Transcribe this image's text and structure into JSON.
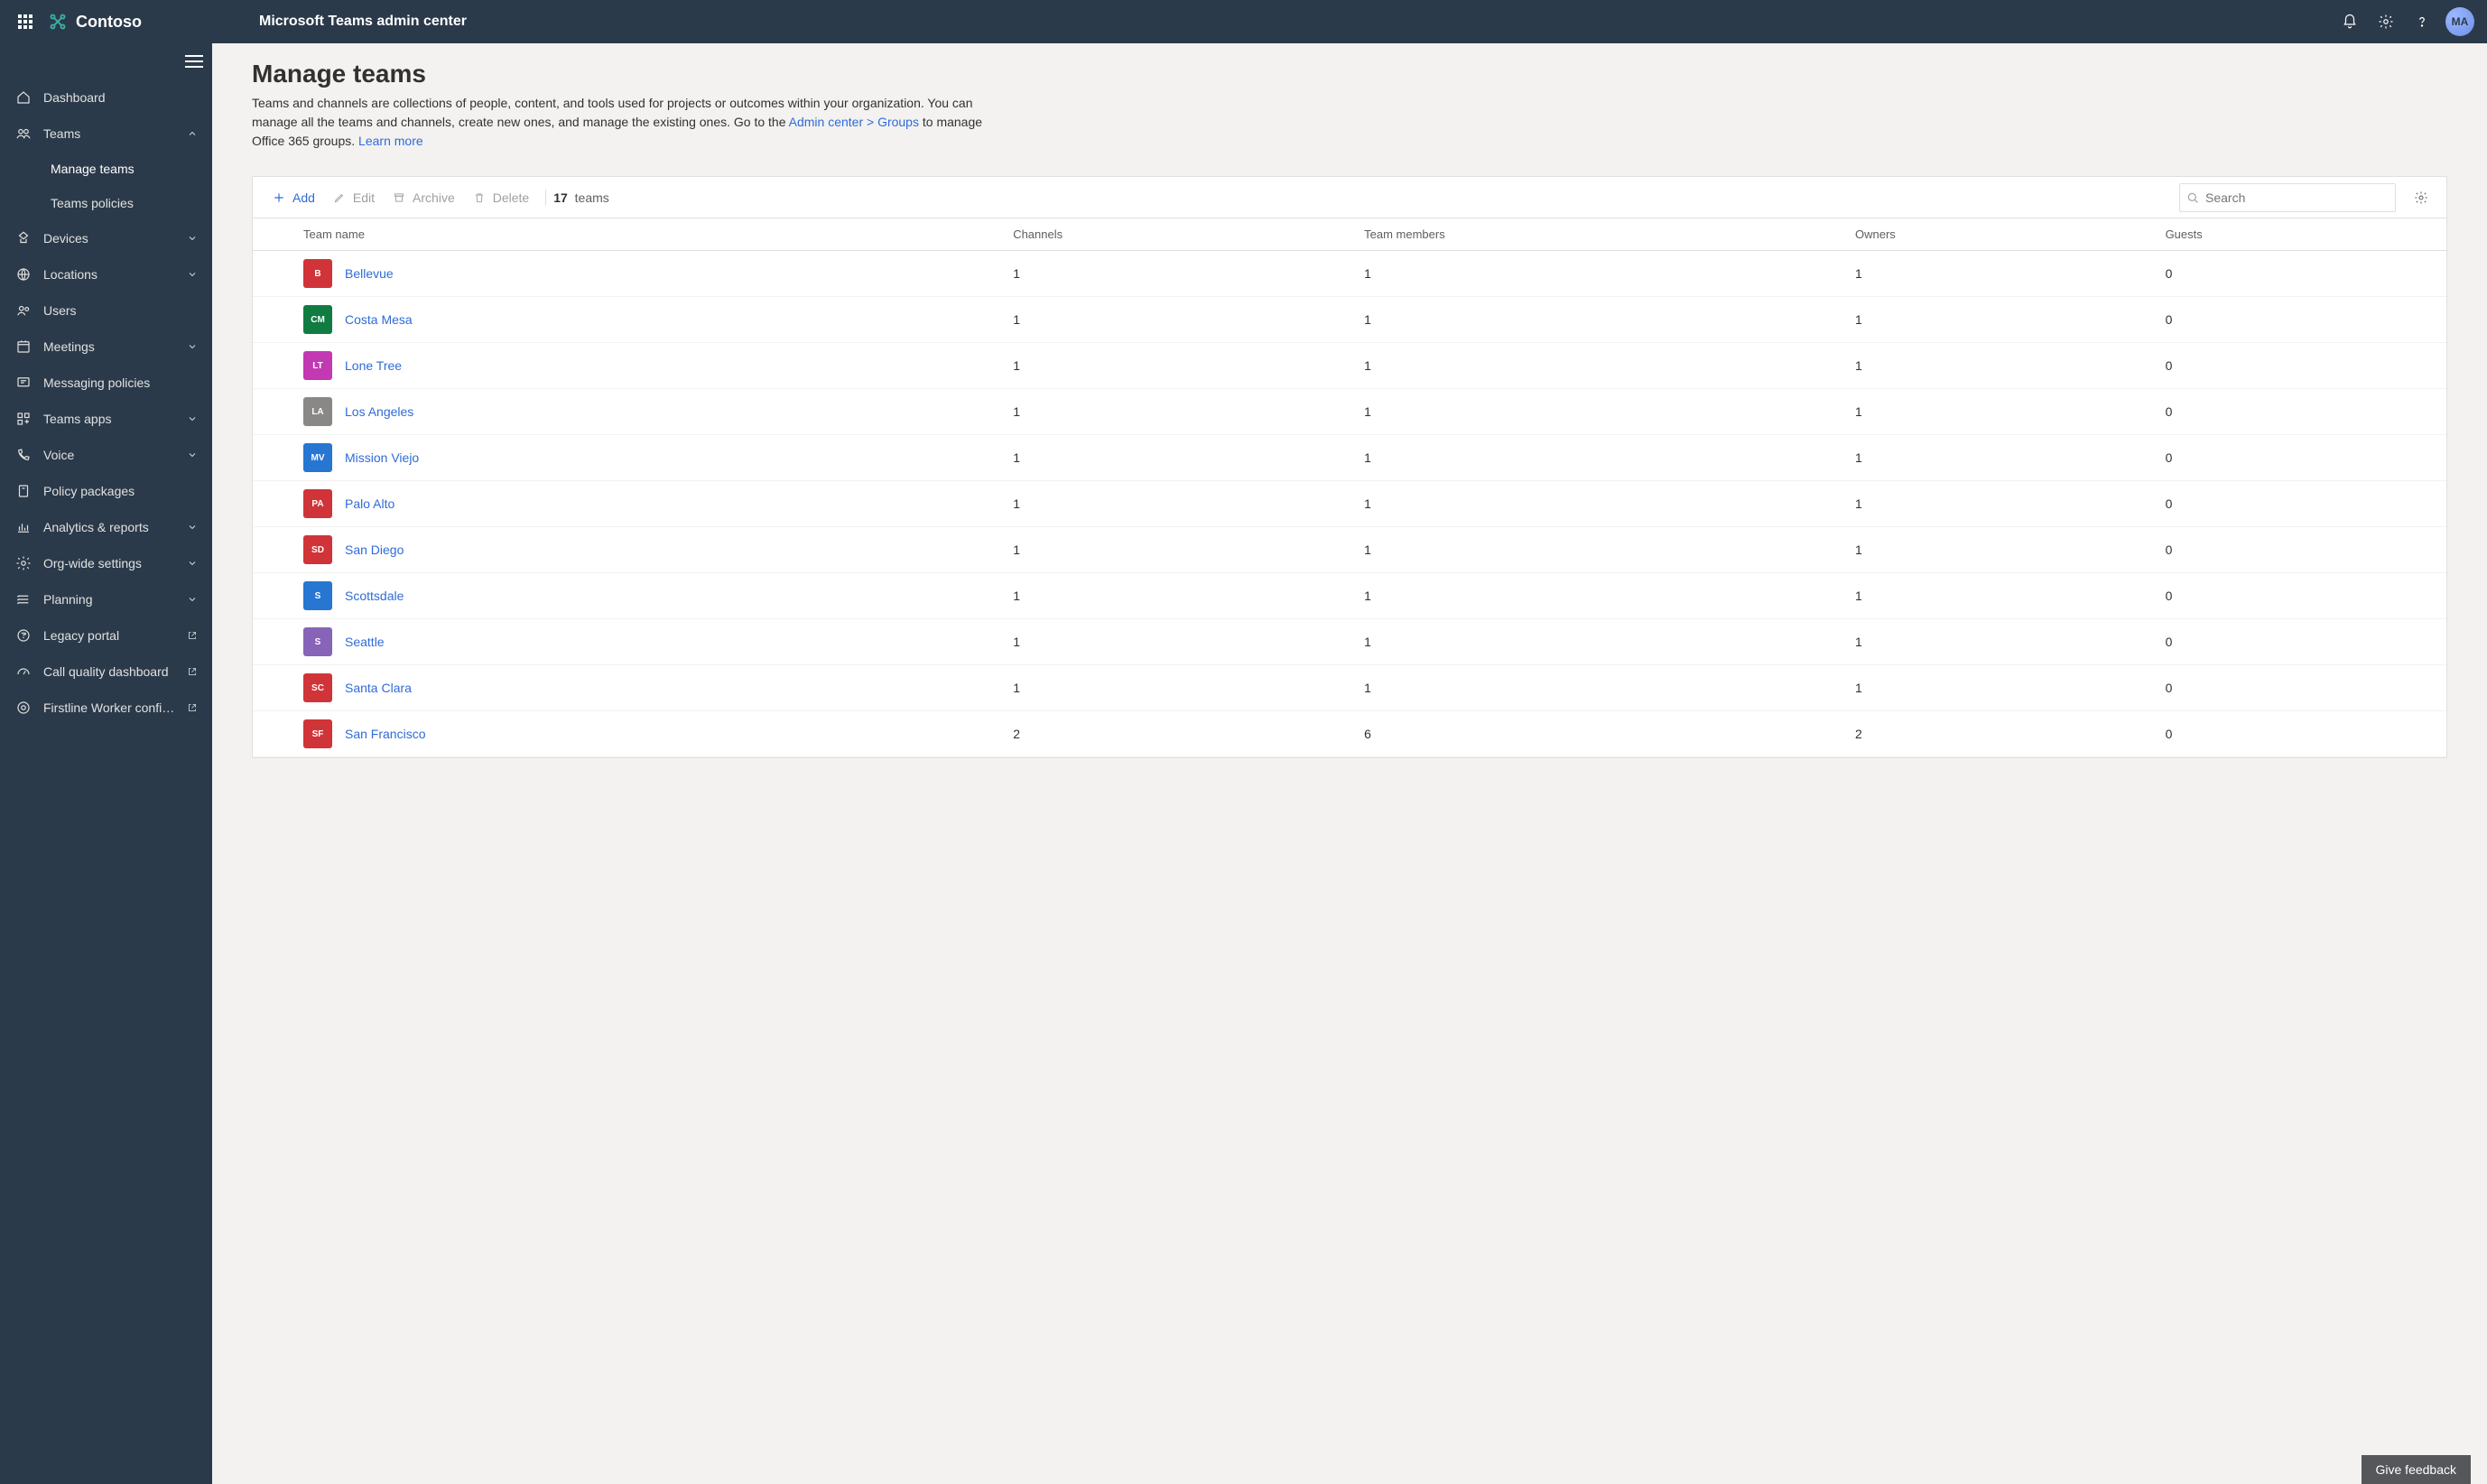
{
  "topbar": {
    "brand": "Contoso",
    "product_title": "Microsoft Teams admin center",
    "avatar_initials": "MA"
  },
  "sidebar": {
    "items": [
      {
        "label": "Dashboard",
        "icon": "home",
        "expandable": false
      },
      {
        "label": "Teams",
        "icon": "people",
        "expandable": true,
        "expanded": true,
        "children": [
          {
            "label": "Manage teams",
            "active": true
          },
          {
            "label": "Teams policies",
            "active": false
          }
        ]
      },
      {
        "label": "Devices",
        "icon": "device",
        "expandable": true
      },
      {
        "label": "Locations",
        "icon": "globe",
        "expandable": true
      },
      {
        "label": "Users",
        "icon": "users",
        "expandable": false
      },
      {
        "label": "Meetings",
        "icon": "calendar",
        "expandable": true
      },
      {
        "label": "Messaging policies",
        "icon": "message",
        "expandable": false
      },
      {
        "label": "Teams apps",
        "icon": "apps",
        "expandable": true
      },
      {
        "label": "Voice",
        "icon": "voice",
        "expandable": true
      },
      {
        "label": "Policy packages",
        "icon": "package",
        "expandable": false
      },
      {
        "label": "Analytics & reports",
        "icon": "analytics",
        "expandable": true
      },
      {
        "label": "Org-wide settings",
        "icon": "settings",
        "expandable": true
      },
      {
        "label": "Planning",
        "icon": "planning",
        "expandable": true
      },
      {
        "label": "Legacy portal",
        "icon": "legacy",
        "external": true
      },
      {
        "label": "Call quality dashboard",
        "icon": "gauge",
        "external": true
      },
      {
        "label": "Firstline Worker configu…",
        "icon": "firstline",
        "external": true
      }
    ]
  },
  "page": {
    "title": "Manage teams",
    "description_pre": "Teams and channels are collections of people, content, and tools used for projects or outcomes within your organization. You can manage all the teams and channels, create new ones, and manage the existing ones. Go to the ",
    "admin_link_text": "Admin center > Groups",
    "description_post": " to manage Office 365 groups. ",
    "learn_more": "Learn more"
  },
  "toolbar": {
    "add": "Add",
    "edit": "Edit",
    "archive": "Archive",
    "delete": "Delete",
    "count_number": "17",
    "count_noun": "teams",
    "search_placeholder": "Search"
  },
  "table": {
    "columns": [
      "Team name",
      "Channels",
      "Team members",
      "Owners",
      "Guests"
    ],
    "rows": [
      {
        "tile": "B",
        "color": "#d13438",
        "name": "Bellevue",
        "channels": "1",
        "members": "1",
        "owners": "1",
        "guests": "0"
      },
      {
        "tile": "CM",
        "color": "#107c41",
        "name": "Costa Mesa",
        "channels": "1",
        "members": "1",
        "owners": "1",
        "guests": "0"
      },
      {
        "tile": "LT",
        "color": "#c239b3",
        "name": "Lone Tree",
        "channels": "1",
        "members": "1",
        "owners": "1",
        "guests": "0"
      },
      {
        "tile": "LA",
        "color": "#8a8886",
        "name": "Los Angeles",
        "channels": "1",
        "members": "1",
        "owners": "1",
        "guests": "0"
      },
      {
        "tile": "MV",
        "color": "#2776d2",
        "name": "Mission Viejo",
        "channels": "1",
        "members": "1",
        "owners": "1",
        "guests": "0"
      },
      {
        "tile": "PA",
        "color": "#d13438",
        "name": "Palo Alto",
        "channels": "1",
        "members": "1",
        "owners": "1",
        "guests": "0"
      },
      {
        "tile": "SD",
        "color": "#d13438",
        "name": "San Diego",
        "channels": "1",
        "members": "1",
        "owners": "1",
        "guests": "0"
      },
      {
        "tile": "S",
        "color": "#2776d2",
        "name": "Scottsdale",
        "channels": "1",
        "members": "1",
        "owners": "1",
        "guests": "0"
      },
      {
        "tile": "S",
        "color": "#8764b8",
        "name": "Seattle",
        "channels": "1",
        "members": "1",
        "owners": "1",
        "guests": "0"
      },
      {
        "tile": "SC",
        "color": "#d13438",
        "name": "Santa Clara",
        "channels": "1",
        "members": "1",
        "owners": "1",
        "guests": "0"
      },
      {
        "tile": "SF",
        "color": "#d13438",
        "name": "San Francisco",
        "channels": "2",
        "members": "6",
        "owners": "2",
        "guests": "0"
      }
    ]
  },
  "feedback_label": "Give feedback"
}
